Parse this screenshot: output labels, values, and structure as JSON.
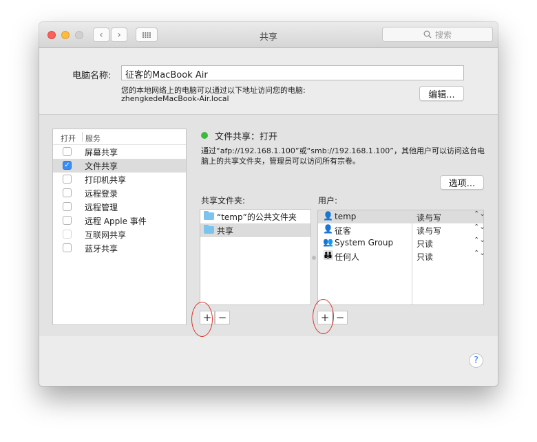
{
  "window": {
    "title": "共享"
  },
  "search": {
    "placeholder": "搜索",
    "icon": "search-icon"
  },
  "computer": {
    "name_label": "电脑名称:",
    "name_value": "征客的MacBook Air",
    "address_desc": "您的本地网络上的电脑可以通过以下地址访问您的电脑:",
    "address": "zhengkedeMacBook-Air.local",
    "edit_label": "编辑..."
  },
  "services": {
    "header_on": "打开",
    "header_service": "服务",
    "items": [
      {
        "label": "屏幕共享",
        "checked": false
      },
      {
        "label": "文件共享",
        "checked": true
      },
      {
        "label": "打印机共享",
        "checked": false
      },
      {
        "label": "远程登录",
        "checked": false
      },
      {
        "label": "远程管理",
        "checked": false
      },
      {
        "label": "远程 Apple 事件",
        "checked": false
      },
      {
        "label": "互联网共享",
        "checked": false
      },
      {
        "label": "蓝牙共享",
        "checked": false
      }
    ]
  },
  "file_sharing": {
    "status": "文件共享：打开",
    "status_color": "#3dba3d",
    "description": "通过“afp://192.168.1.100”或“smb://192.168.1.100”，其他用户可以访问这台电脑上的共享文件夹，管理员可以访问所有宗卷。",
    "options_label": "选项...",
    "folders_label": "共享文件夹:",
    "folders": [
      "“temp”的公共文件夹",
      "共享"
    ],
    "users_label": "用户:",
    "users": [
      {
        "name": "temp",
        "perm": "读与写",
        "icon": "user-icon"
      },
      {
        "name": "征客",
        "perm": "读与写",
        "icon": "user-icon"
      },
      {
        "name": "System Group",
        "perm": "只读",
        "icon": "group-icon"
      },
      {
        "name": "任何人",
        "perm": "只读",
        "icon": "everyone-icon"
      }
    ],
    "add_label": "+",
    "remove_label": "−"
  },
  "help_label": "?",
  "annotation_color": "#e0302a"
}
